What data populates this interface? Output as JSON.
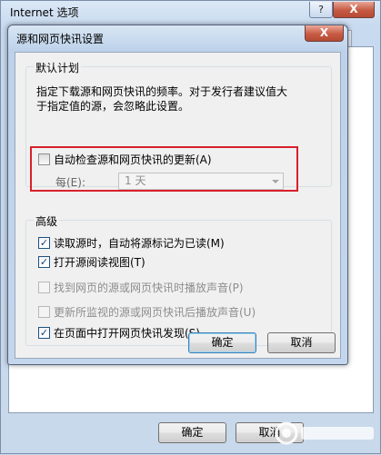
{
  "background_window": {
    "title": "Internet 选项",
    "help_glyph": "?",
    "close_glyph": "X",
    "tabs": [
      "",
      "",
      "",
      "",
      "",
      "",
      ""
    ],
    "ok_label": "确定",
    "cancel_label": "取消"
  },
  "dialog": {
    "title": "源和网页快讯设置",
    "close_glyph": "X",
    "default_schedule": {
      "group_label": "默认计划",
      "description_line1": "指定下载源和网页快讯的频率。对于发行者建议值大",
      "description_line2": "于指定值的源，会忽略此设置。",
      "auto_check": {
        "label": "自动检查源和网页快讯的更新(A)",
        "checked": false
      },
      "every_label": "每(E):",
      "every_value": "1 天"
    },
    "advanced": {
      "group_label": "高级",
      "options": [
        {
          "label": "读取源时，自动将源标记为已读(M)",
          "checked": true,
          "enabled": true
        },
        {
          "label": "打开源阅读视图(T)",
          "checked": true,
          "enabled": true
        },
        {
          "label": "找到网页的源或网页快讯时播放声音(P)",
          "checked": false,
          "enabled": false
        },
        {
          "label": "更新所监视的源或网页快讯后播放声音(U)",
          "checked": false,
          "enabled": false
        },
        {
          "label": "在页面中打开网页快讯发现(S)",
          "checked": true,
          "enabled": true
        }
      ]
    },
    "ok_label": "确定",
    "cancel_label": "取消"
  },
  "colors": {
    "highlight": "#d9212b",
    "titlebar": "#bdd2ea",
    "client": "#f0f0f0"
  }
}
